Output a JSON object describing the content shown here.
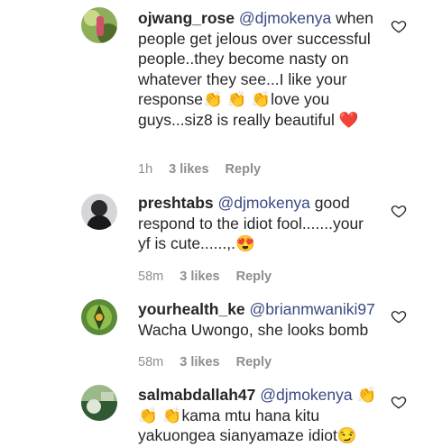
{
  "comments": [
    {
      "username": "ojwang_rose",
      "mention": "@djmokenya",
      "text": " when people get jelous over successful people..they become nasty on whatever they see...I like your response👏 👏 👏love you guys...siz8 is really beautiful ❤️",
      "time": "1h",
      "likes": "3 likes",
      "reply": "Reply",
      "avatar_color": "#6a8a3a"
    },
    {
      "username": "preshtabs",
      "mention": "@djmokenya",
      "text": " good respond to the idiot fool.......your yf is cute......,.😍",
      "time": "58m",
      "likes": "3 likes",
      "reply": "Reply",
      "avatar_color": "#7a7a80"
    },
    {
      "username": "yourhealth_ke",
      "mention": "@brianmwaniki97",
      "text": " Wacha Uwongo, she looks bomb",
      "time": "58m",
      "likes": "3 likes",
      "reply": "Reply",
      "avatar_color": "#4f7a2e"
    },
    {
      "username": "salmabdallah47",
      "mention": "@djmokenya",
      "text": " 👏 👏 👏kama mtu hana kitu yakuongea sianyamaze idiot😏",
      "avatar_color": "#3b6e3f"
    }
  ],
  "icons": {
    "like": "heart-outline-icon"
  }
}
